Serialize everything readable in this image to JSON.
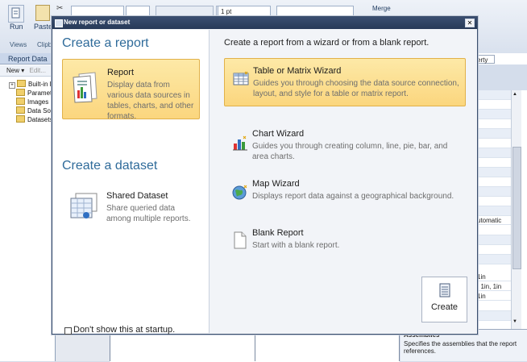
{
  "ribbon": {
    "run_label": "Run",
    "paste_label": "Paste",
    "views_group": "Views",
    "clipboard_group": "Clipbo",
    "font_size_value": "1 pt",
    "merge_label": "Merge"
  },
  "report_data": {
    "header": "Report Data",
    "new_label": "New ▾",
    "edit_label": "Edit...",
    "tree": [
      "Built-in Fi",
      "Paramete",
      "Images",
      "Data Sou",
      "Datasets"
    ]
  },
  "properties": {
    "tab_fragment": "erty",
    "values": [
      "utomatic",
      "1in",
      ", 1in, 1in",
      "1in"
    ],
    "desc_title": "Assemblies",
    "desc_text": "Specifies the assemblies that the report references."
  },
  "dialog": {
    "title": "New report or dataset",
    "close_label": "✕",
    "create_report_heading": "Create a report",
    "report_card": {
      "title": "Report",
      "desc": "Display data from various data sources in tables, charts, and other formats."
    },
    "create_dataset_heading": "Create a dataset",
    "dataset_card": {
      "title": "Shared Dataset",
      "desc": "Share queried data among multiple reports."
    },
    "startup_checkbox_label": "Don't show this at startup.",
    "right_intro": "Create a report from a wizard or from a blank report.",
    "options": [
      {
        "title": "Table or Matrix Wizard",
        "desc": "Guides you through choosing the data source connection, layout, and style for a table or matrix report.",
        "icon": "table-wizard-icon",
        "selected": true
      },
      {
        "title": "Chart Wizard",
        "desc": "Guides you through creating column, line, pie, bar, and area charts.",
        "icon": "chart-wizard-icon",
        "selected": false
      },
      {
        "title": "Map Wizard",
        "desc": "Displays report data against a geographical background.",
        "icon": "map-wizard-icon",
        "selected": false
      },
      {
        "title": "Blank Report",
        "desc": "Start with a blank report.",
        "icon": "blank-report-icon",
        "selected": false
      }
    ],
    "create_button_label": "Create"
  },
  "colors": {
    "accent_heading": "#2f6b9a",
    "selection_fill": "#fbd67e",
    "titlebar": "#2f4364"
  }
}
